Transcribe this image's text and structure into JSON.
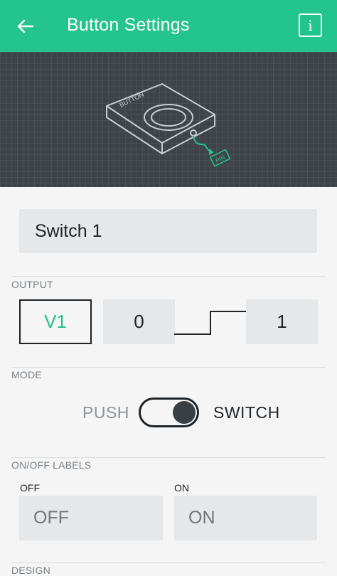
{
  "header": {
    "title": "Button Settings",
    "back_icon": "arrow-left-icon",
    "info_icon": "info-icon",
    "info_glyph": "i",
    "color": "#23c48e"
  },
  "illustration": {
    "device_label": "BUTTON",
    "pin_label": "PIN"
  },
  "name_field": {
    "value": "Switch 1"
  },
  "output": {
    "label": "OUTPUT",
    "pin": "V1",
    "low_value": "0",
    "high_value": "1"
  },
  "mode": {
    "label": "MODE",
    "push_label": "PUSH",
    "switch_label": "SWITCH",
    "selected": "SWITCH"
  },
  "onoff_labels": {
    "label": "ON/OFF LABELS",
    "off_caption": "OFF",
    "on_caption": "ON",
    "off_value": "OFF",
    "on_value": "ON"
  },
  "design": {
    "label": "DESIGN"
  }
}
